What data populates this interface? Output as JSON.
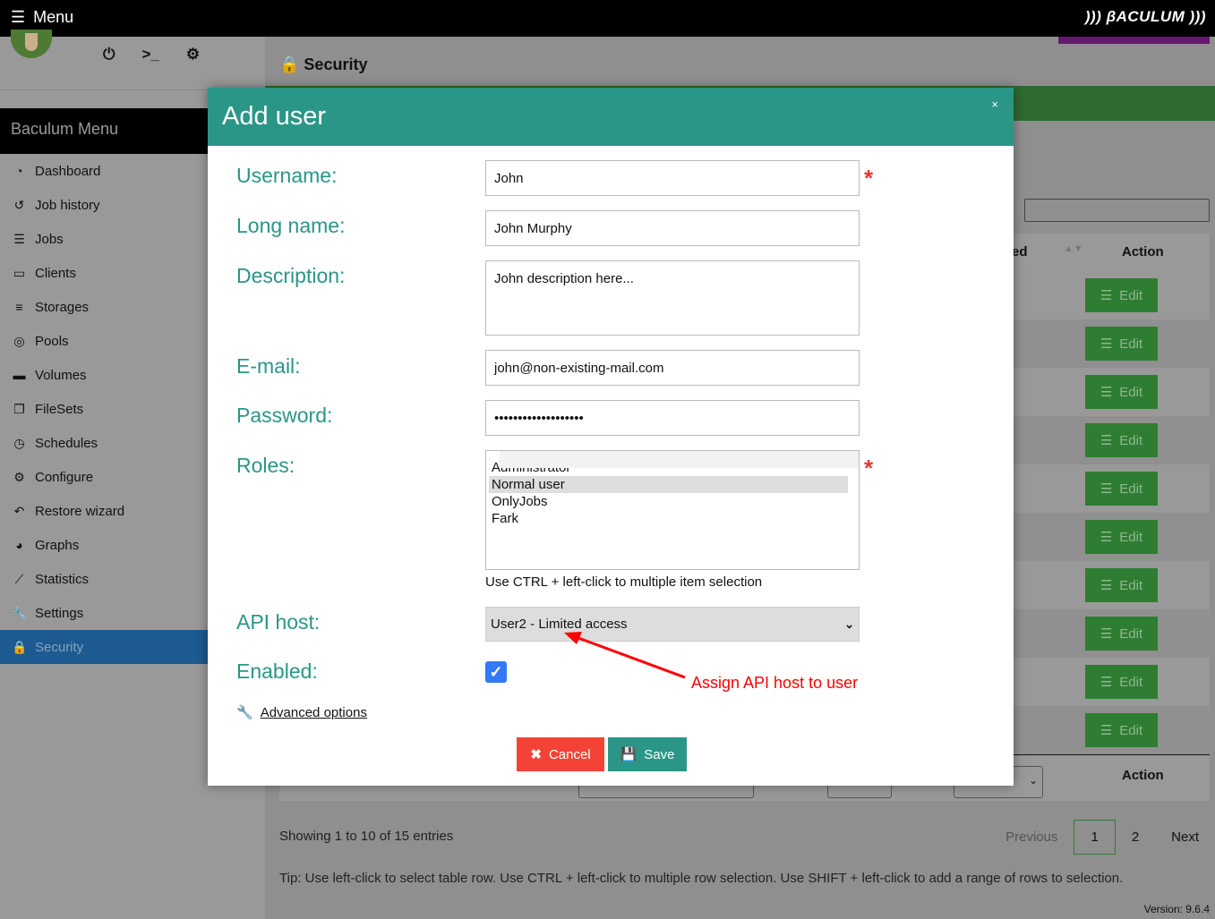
{
  "topbar": {
    "menu_label": "Menu",
    "logo": "))) βACULUM )))"
  },
  "sidebar": {
    "title": "Baculum Menu",
    "items": [
      {
        "label": "Dashboard",
        "icon": "tachometer-icon"
      },
      {
        "label": "Job history",
        "icon": "history-icon"
      },
      {
        "label": "Jobs",
        "icon": "tasks-icon"
      },
      {
        "label": "Clients",
        "icon": "desktop-icon"
      },
      {
        "label": "Storages",
        "icon": "database-icon"
      },
      {
        "label": "Pools",
        "icon": "tape-icon"
      },
      {
        "label": "Volumes",
        "icon": "hdd-icon"
      },
      {
        "label": "FileSets",
        "icon": "copy-icon"
      },
      {
        "label": "Schedules",
        "icon": "clock-icon"
      },
      {
        "label": "Configure",
        "icon": "cog-icon"
      },
      {
        "label": "Restore wizard",
        "icon": "undo-icon"
      },
      {
        "label": "Graphs",
        "icon": "pie-chart-icon"
      },
      {
        "label": "Statistics",
        "icon": "line-chart-icon"
      },
      {
        "label": "Settings",
        "icon": "wrench-icon"
      },
      {
        "label": "Security",
        "icon": "lock-icon",
        "active": true
      }
    ]
  },
  "page": {
    "title": "Security",
    "table_header_partial": "ed",
    "action_header": "Action",
    "edit_label": "Edit",
    "showing": "Showing 1 to 10 of 15 entries",
    "pagination": {
      "previous": "Previous",
      "pages": [
        "1",
        "2"
      ],
      "current": "1",
      "next": "Next"
    },
    "tip": "Tip: Use left-click to select table row. Use CTRL + left-click to multiple row selection. Use SHIFT + left-click to add a range of rows to selection.",
    "version": "Version: 9.6.4"
  },
  "modal": {
    "title": "Add user",
    "close": "×",
    "labels": {
      "username": "Username:",
      "longname": "Long name:",
      "description": "Description:",
      "email": "E-mail:",
      "password": "Password:",
      "roles": "Roles:",
      "apihost": "API host:",
      "enabled": "Enabled:"
    },
    "values": {
      "username": "John",
      "longname": "John Murphy",
      "description": "John description here...",
      "email": "john@non-existing-mail.com",
      "password": "•••••••••••••••••••"
    },
    "roles": [
      "Administrator",
      "Normal user",
      "OnlyJobs",
      "Fark"
    ],
    "selected_role": "Normal user",
    "roles_hint": "Use CTRL + left-click to multiple item selection",
    "apihost": "User2 - Limited access",
    "enabled": true,
    "annotation": "Assign API host to user",
    "advanced": "Advanced options",
    "cancel": "Cancel",
    "save": "Save",
    "required_mark": "*"
  },
  "colors": {
    "accent": "#2a9687",
    "cancel": "#f44336",
    "annotation": "#ff0000"
  }
}
